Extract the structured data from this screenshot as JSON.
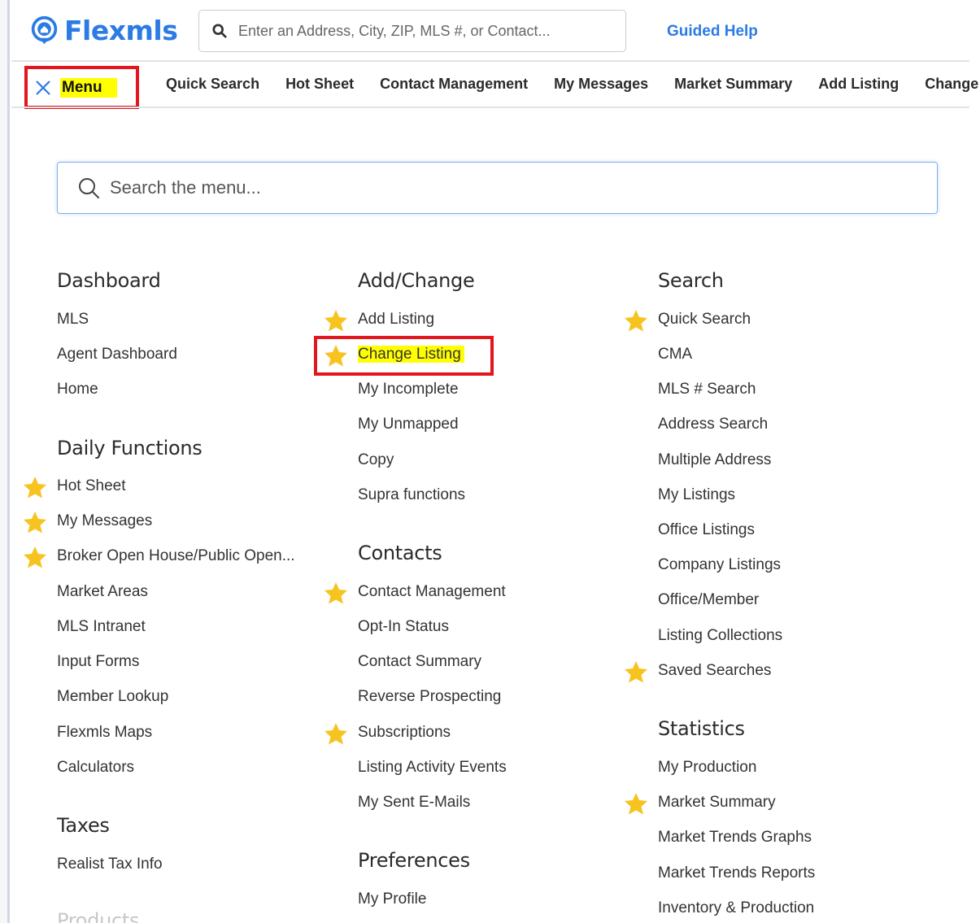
{
  "header": {
    "logo_text": "Flexmls",
    "search_placeholder": "Enter an Address, City, ZIP, MLS #, or Contact...",
    "guided_help": "Guided Help"
  },
  "nav": {
    "menu_label": "Menu",
    "items": [
      "Quick Search",
      "Hot Sheet",
      "Contact Management",
      "My Messages",
      "Market Summary",
      "Add Listing",
      "Change"
    ]
  },
  "menu_search": {
    "placeholder": "Search the menu..."
  },
  "columns": {
    "dashboard": {
      "title": "Dashboard",
      "items": [
        "MLS",
        "Agent Dashboard",
        "Home"
      ]
    },
    "daily_functions": {
      "title": "Daily Functions",
      "items": [
        "Hot Sheet",
        "My Messages",
        "Broker Open House/Public Open...",
        "Market Areas",
        "MLS Intranet",
        "Input Forms",
        "Member Lookup",
        "Flexmls Maps",
        "Calculators"
      ]
    },
    "taxes": {
      "title": "Taxes",
      "items": [
        "Realist Tax Info"
      ]
    },
    "products": {
      "title": "Products"
    },
    "add_change": {
      "title": "Add/Change",
      "items": [
        "Add Listing",
        "Change Listing",
        "My Incomplete",
        "My Unmapped",
        "Copy",
        "Supra functions"
      ]
    },
    "contacts": {
      "title": "Contacts",
      "items": [
        "Contact Management",
        "Opt-In Status",
        "Contact Summary",
        "Reverse Prospecting",
        "Subscriptions",
        "Listing Activity Events",
        "My Sent E-Mails"
      ]
    },
    "preferences": {
      "title": "Preferences",
      "items": [
        "My Profile"
      ]
    },
    "search": {
      "title": "Search",
      "items": [
        "Quick Search",
        "CMA",
        "MLS # Search",
        "Address Search",
        "Multiple Address",
        "My Listings",
        "Office Listings",
        "Company Listings",
        "Office/Member",
        "Listing Collections",
        "Saved Searches"
      ]
    },
    "statistics": {
      "title": "Statistics",
      "items": [
        "My Production",
        "Market Summary",
        "Market Trends Graphs",
        "Market Trends Reports",
        "Inventory & Production"
      ]
    }
  },
  "colors": {
    "brand_blue": "#2c7be5",
    "star": "#f7c31f",
    "highlight": "#ffff00",
    "annotation_red": "#e3161d"
  }
}
